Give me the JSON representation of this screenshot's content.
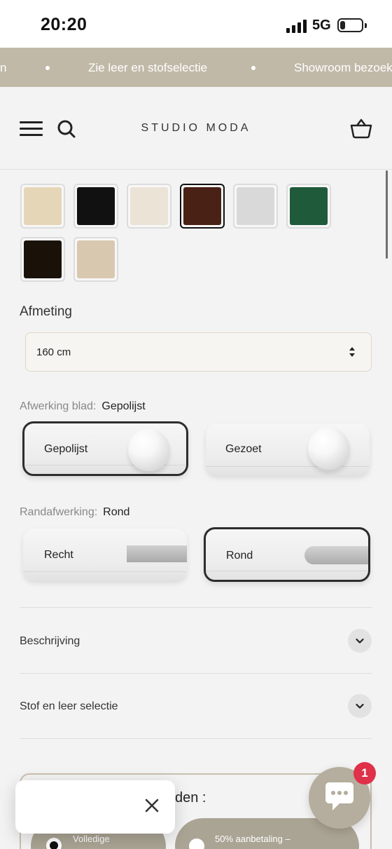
{
  "status_bar": {
    "time": "20:20",
    "network": "5G",
    "battery": "21",
    "battery_level": 0.21
  },
  "announcement": {
    "items": [
      "n",
      "Zie leer en stofselectie",
      "Showroom bezoek"
    ]
  },
  "header": {
    "logo": "STUDIO MODA"
  },
  "icons": [
    "menu-icon",
    "search-icon",
    "cart-icon",
    "chevron-down-icon",
    "close-icon",
    "chat-icon"
  ],
  "swatches": {
    "selected_index": 3,
    "items": [
      {
        "name": "cream-marble",
        "color": "#e6d6b8"
      },
      {
        "name": "black-marble",
        "color": "#111111"
      },
      {
        "name": "ivory-marble",
        "color": "#ece3d7"
      },
      {
        "name": "brown-marble",
        "color": "#4a2115"
      },
      {
        "name": "white-grey-marble",
        "color": "#d9d9d9"
      },
      {
        "name": "green-marble",
        "color": "#1f5a3a"
      },
      {
        "name": "black-gold-marble",
        "color": "#1a1208"
      },
      {
        "name": "beige-marble",
        "color": "#d9c8b0"
      }
    ]
  },
  "size": {
    "label": "Afmeting",
    "value": "160 cm"
  },
  "finish": {
    "label": "Afwerking blad:",
    "selected": "Gepolijst",
    "options": [
      "Gepolijst",
      "Gezoet"
    ]
  },
  "edge": {
    "label": "Randafwerking:",
    "selected": "Rond",
    "options": [
      "Recht",
      "Rond"
    ]
  },
  "accordions": [
    {
      "title": "Beschrijving"
    },
    {
      "title": "Stof en leer selectie"
    }
  ],
  "payment": {
    "title": "den :",
    "option_full": "Volledige",
    "option_deposit": "50% aanbetaling –"
  },
  "chat": {
    "badge": "1"
  },
  "colors": {
    "accent": "#c1b9a8",
    "badge": "#e0314a"
  }
}
